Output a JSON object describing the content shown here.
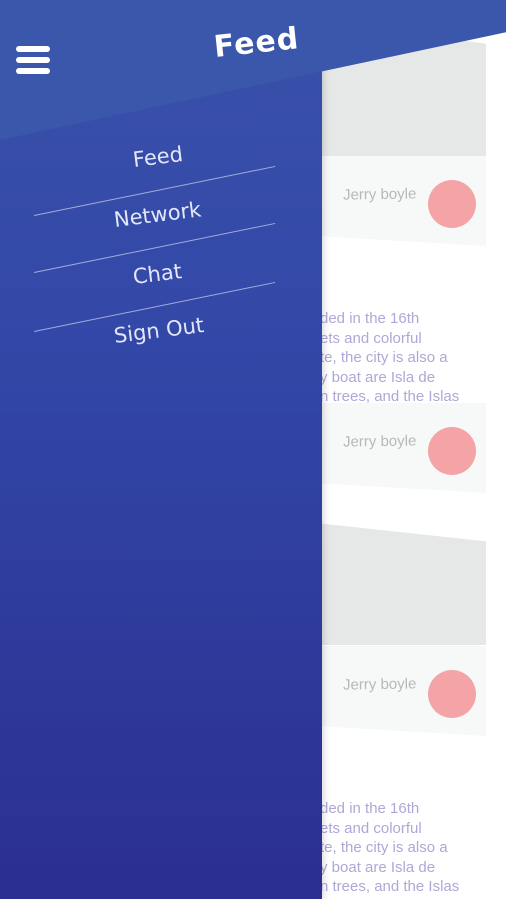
{
  "header": {
    "title": "Feed",
    "menu_icon": "hamburger-icon"
  },
  "drawer": {
    "items": [
      {
        "label": "Feed"
      },
      {
        "label": "Network"
      },
      {
        "label": "Chat"
      },
      {
        "label": "Sign Out"
      }
    ]
  },
  "feed": {
    "posts": [
      {
        "author": "Jerry boyle"
      },
      {
        "author": "Jerry boyle",
        "excerpt": [
          "ded in the 16th",
          "ets and colorful",
          "te, the city is also a",
          "y boat are Isla de",
          "n trees, and the Islas"
        ]
      },
      {
        "author": "Jerry boyle",
        "excerpt": [
          "ded in the 16th",
          "ets and colorful",
          "te, the city is also a",
          "y boat are Isla de",
          "n trees, and the Islas"
        ]
      }
    ]
  },
  "colors": {
    "drawer_top": "#3a52ab",
    "drawer_bottom": "#2b2f8f",
    "avatar": "#f4a3a6",
    "excerpt_text": "#b0a7d6"
  }
}
